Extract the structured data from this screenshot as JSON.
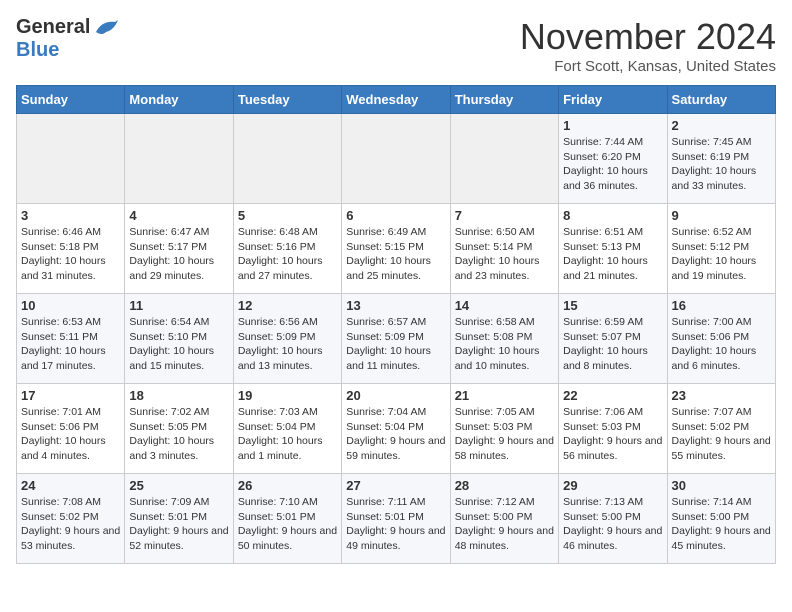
{
  "header": {
    "logo_line1": "General",
    "logo_line2": "Blue",
    "title": "November 2024",
    "subtitle": "Fort Scott, Kansas, United States"
  },
  "days_of_week": [
    "Sunday",
    "Monday",
    "Tuesday",
    "Wednesday",
    "Thursday",
    "Friday",
    "Saturday"
  ],
  "weeks": [
    {
      "days": [
        {
          "date": "",
          "info": ""
        },
        {
          "date": "",
          "info": ""
        },
        {
          "date": "",
          "info": ""
        },
        {
          "date": "",
          "info": ""
        },
        {
          "date": "",
          "info": ""
        },
        {
          "date": "1",
          "info": "Sunrise: 7:44 AM\nSunset: 6:20 PM\nDaylight: 10 hours and 36 minutes."
        },
        {
          "date": "2",
          "info": "Sunrise: 7:45 AM\nSunset: 6:19 PM\nDaylight: 10 hours and 33 minutes."
        }
      ]
    },
    {
      "days": [
        {
          "date": "3",
          "info": "Sunrise: 6:46 AM\nSunset: 5:18 PM\nDaylight: 10 hours and 31 minutes."
        },
        {
          "date": "4",
          "info": "Sunrise: 6:47 AM\nSunset: 5:17 PM\nDaylight: 10 hours and 29 minutes."
        },
        {
          "date": "5",
          "info": "Sunrise: 6:48 AM\nSunset: 5:16 PM\nDaylight: 10 hours and 27 minutes."
        },
        {
          "date": "6",
          "info": "Sunrise: 6:49 AM\nSunset: 5:15 PM\nDaylight: 10 hours and 25 minutes."
        },
        {
          "date": "7",
          "info": "Sunrise: 6:50 AM\nSunset: 5:14 PM\nDaylight: 10 hours and 23 minutes."
        },
        {
          "date": "8",
          "info": "Sunrise: 6:51 AM\nSunset: 5:13 PM\nDaylight: 10 hours and 21 minutes."
        },
        {
          "date": "9",
          "info": "Sunrise: 6:52 AM\nSunset: 5:12 PM\nDaylight: 10 hours and 19 minutes."
        }
      ]
    },
    {
      "days": [
        {
          "date": "10",
          "info": "Sunrise: 6:53 AM\nSunset: 5:11 PM\nDaylight: 10 hours and 17 minutes."
        },
        {
          "date": "11",
          "info": "Sunrise: 6:54 AM\nSunset: 5:10 PM\nDaylight: 10 hours and 15 minutes."
        },
        {
          "date": "12",
          "info": "Sunrise: 6:56 AM\nSunset: 5:09 PM\nDaylight: 10 hours and 13 minutes."
        },
        {
          "date": "13",
          "info": "Sunrise: 6:57 AM\nSunset: 5:09 PM\nDaylight: 10 hours and 11 minutes."
        },
        {
          "date": "14",
          "info": "Sunrise: 6:58 AM\nSunset: 5:08 PM\nDaylight: 10 hours and 10 minutes."
        },
        {
          "date": "15",
          "info": "Sunrise: 6:59 AM\nSunset: 5:07 PM\nDaylight: 10 hours and 8 minutes."
        },
        {
          "date": "16",
          "info": "Sunrise: 7:00 AM\nSunset: 5:06 PM\nDaylight: 10 hours and 6 minutes."
        }
      ]
    },
    {
      "days": [
        {
          "date": "17",
          "info": "Sunrise: 7:01 AM\nSunset: 5:06 PM\nDaylight: 10 hours and 4 minutes."
        },
        {
          "date": "18",
          "info": "Sunrise: 7:02 AM\nSunset: 5:05 PM\nDaylight: 10 hours and 3 minutes."
        },
        {
          "date": "19",
          "info": "Sunrise: 7:03 AM\nSunset: 5:04 PM\nDaylight: 10 hours and 1 minute."
        },
        {
          "date": "20",
          "info": "Sunrise: 7:04 AM\nSunset: 5:04 PM\nDaylight: 9 hours and 59 minutes."
        },
        {
          "date": "21",
          "info": "Sunrise: 7:05 AM\nSunset: 5:03 PM\nDaylight: 9 hours and 58 minutes."
        },
        {
          "date": "22",
          "info": "Sunrise: 7:06 AM\nSunset: 5:03 PM\nDaylight: 9 hours and 56 minutes."
        },
        {
          "date": "23",
          "info": "Sunrise: 7:07 AM\nSunset: 5:02 PM\nDaylight: 9 hours and 55 minutes."
        }
      ]
    },
    {
      "days": [
        {
          "date": "24",
          "info": "Sunrise: 7:08 AM\nSunset: 5:02 PM\nDaylight: 9 hours and 53 minutes."
        },
        {
          "date": "25",
          "info": "Sunrise: 7:09 AM\nSunset: 5:01 PM\nDaylight: 9 hours and 52 minutes."
        },
        {
          "date": "26",
          "info": "Sunrise: 7:10 AM\nSunset: 5:01 PM\nDaylight: 9 hours and 50 minutes."
        },
        {
          "date": "27",
          "info": "Sunrise: 7:11 AM\nSunset: 5:01 PM\nDaylight: 9 hours and 49 minutes."
        },
        {
          "date": "28",
          "info": "Sunrise: 7:12 AM\nSunset: 5:00 PM\nDaylight: 9 hours and 48 minutes."
        },
        {
          "date": "29",
          "info": "Sunrise: 7:13 AM\nSunset: 5:00 PM\nDaylight: 9 hours and 46 minutes."
        },
        {
          "date": "30",
          "info": "Sunrise: 7:14 AM\nSunset: 5:00 PM\nDaylight: 9 hours and 45 minutes."
        }
      ]
    }
  ]
}
